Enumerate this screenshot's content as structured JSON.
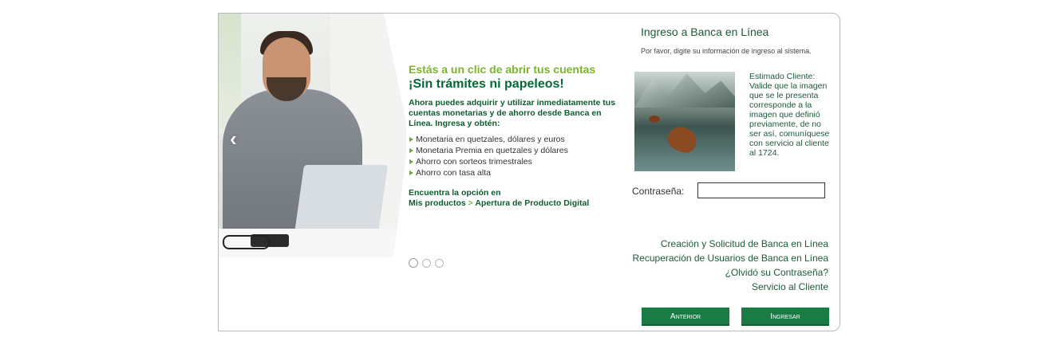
{
  "banner": {
    "headline1": "Estás a un clic de abrir tus cuentas",
    "headline2": "¡Sin trámites ni papeleos!",
    "intro": "Ahora puedes adquirir y utilizar inmediatamente tus cuentas monetarias y de ahorro desde Banca en Línea. Ingresa y obtén:",
    "bullets": [
      "Monetaria en quetzales, dólares y euros",
      "Monetaria Premia en quetzales y dólares",
      "Ahorro con sorteos trimestrales",
      "Ahorro con tasa alta"
    ],
    "find": "Encuentra la opción en",
    "path_part1": "Mis productos",
    "path_sep": " > ",
    "path_part2": "Apertura de Producto Digital",
    "prev_arrow": "‹"
  },
  "login": {
    "title": "Ingreso a Banca en Línea",
    "subtitle": "Por favor, digite su información de ingreso al sistema.",
    "security_note": "Estimado Cliente: Valide que la imagen que se le presenta corresponde a la imagen que definió previamente, de no ser así, comuníquese con servicio al cliente al 1724.",
    "password_label": "Contraseña:",
    "password_value": "",
    "links": [
      "Creación y Solicitud de Banca en Línea",
      "Recuperación de Usuarios de Banca en Línea",
      "¿Olvidó su Contraseña?",
      "Servicio al Cliente"
    ],
    "btn_prev": "Anterior",
    "btn_login": "Ingresar"
  },
  "colors": {
    "brand_green": "#1b7b44",
    "accent_lime": "#7cb42c",
    "text_green": "#1e5a3a"
  },
  "carousel": {
    "current": 1,
    "count": 3
  }
}
